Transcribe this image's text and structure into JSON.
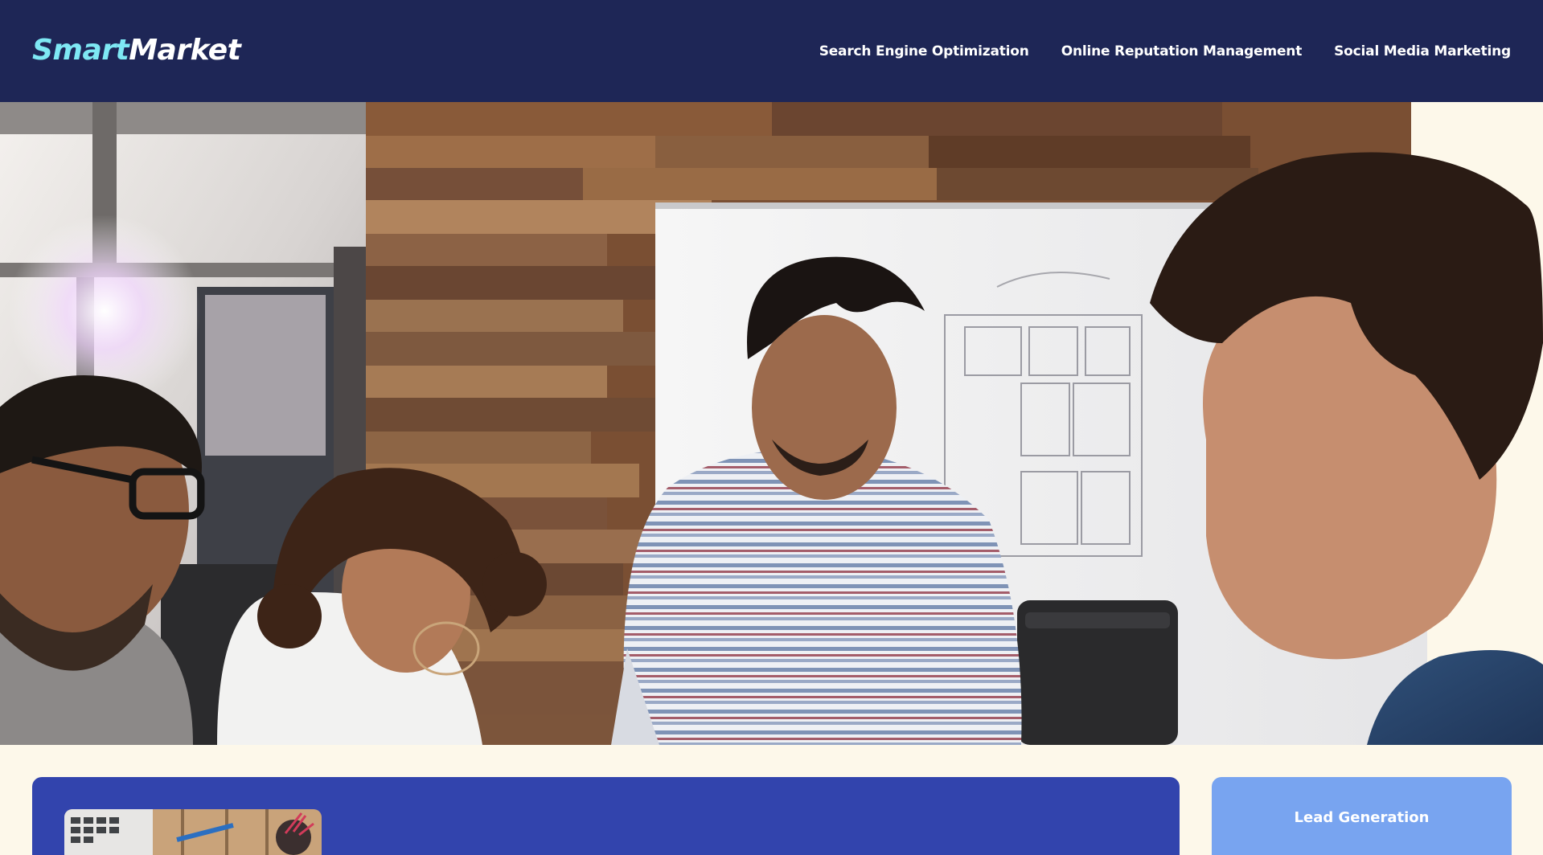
{
  "brand": {
    "part1": "Smart",
    "part2": "Market"
  },
  "nav": {
    "items": [
      {
        "label": "Search Engine Optimization"
      },
      {
        "label": "Online Reputation Management"
      },
      {
        "label": "Social Media Marketing"
      }
    ]
  },
  "hero": {
    "alt": "team meeting around a table in an office"
  },
  "sidebar_card": {
    "title": "Lead Generation"
  },
  "colors": {
    "navbar": "#1e2656",
    "brand_accent": "#7ee8f4",
    "page_background": "#fdf8ea",
    "main_card": "#3244ad",
    "side_card": "#78a4f0"
  }
}
